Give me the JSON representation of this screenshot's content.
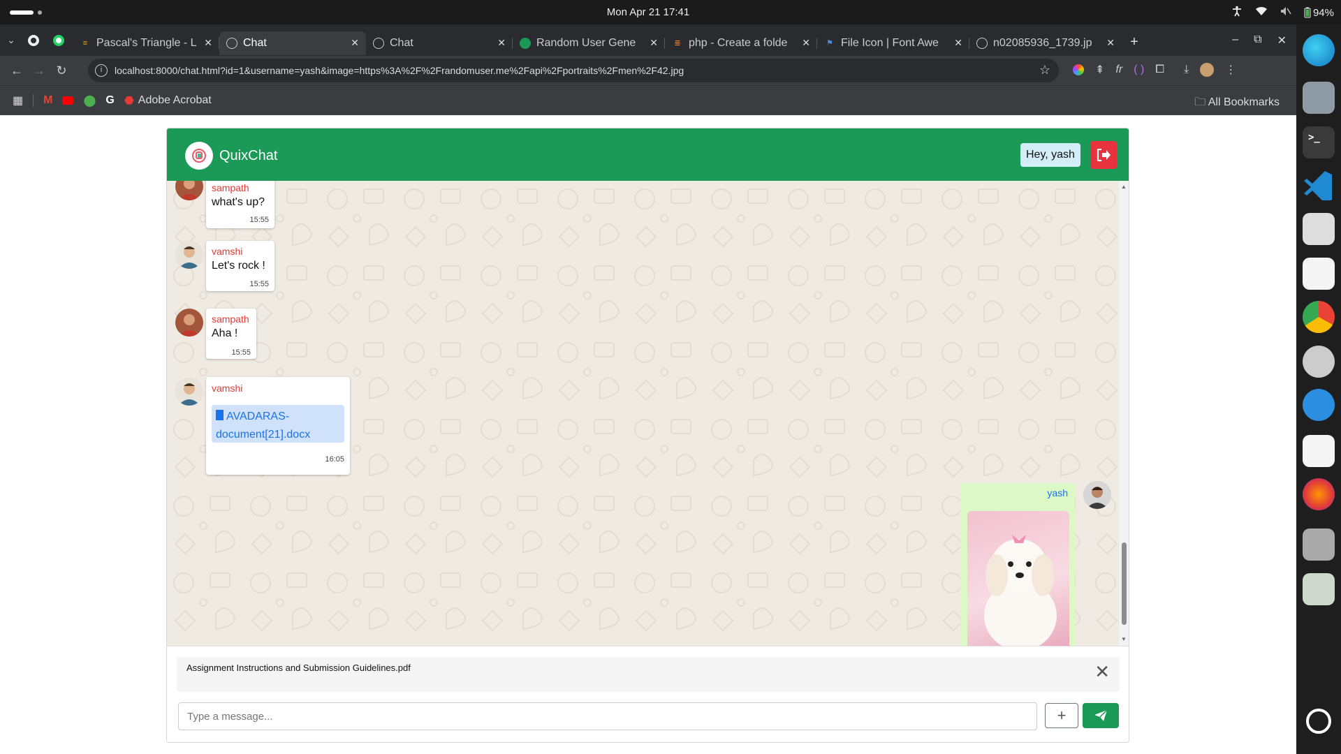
{
  "system": {
    "clock": "Mon Apr 21  17:41",
    "battery": "94%"
  },
  "browser": {
    "tabs": [
      {
        "title": "Pascal's Triangle - L",
        "active": false
      },
      {
        "title": "Chat",
        "active": true
      },
      {
        "title": "Chat",
        "active": false
      },
      {
        "title": "Random User Gene",
        "active": false
      },
      {
        "title": "php - Create a folde",
        "active": false
      },
      {
        "title": "File Icon | Font Awe",
        "active": false
      },
      {
        "title": "n02085936_1739.jp",
        "active": false
      }
    ],
    "url": "localhost:8000/chat.html?id=1&username=yash&image=https%3A%2F%2Frandomuser.me%2Fapi%2Fportraits%2Fmen%2F42.jpg",
    "bookmarks": {
      "acrobat": "Adobe Acrobat",
      "all": "All Bookmarks"
    }
  },
  "app": {
    "brand": "QuixChat",
    "greeting": "Hey, yash",
    "accent": "#1a9a56",
    "messages": [
      {
        "user": "sampath",
        "text": "what's up?",
        "time": "15:55"
      },
      {
        "user": "vamshi",
        "text": "Let's rock !",
        "time": "15:55"
      },
      {
        "user": "sampath",
        "text": "Aha !",
        "time": "15:55"
      },
      {
        "user": "vamshi",
        "file": "AVADARAS-document[21].docx",
        "time": "16:05"
      },
      {
        "user": "yash",
        "image": "puppy photo"
      }
    ],
    "attachment": "Assignment Instructions and Submission Guidelines.pdf",
    "input_placeholder": "Type a message...",
    "plus": "+"
  }
}
